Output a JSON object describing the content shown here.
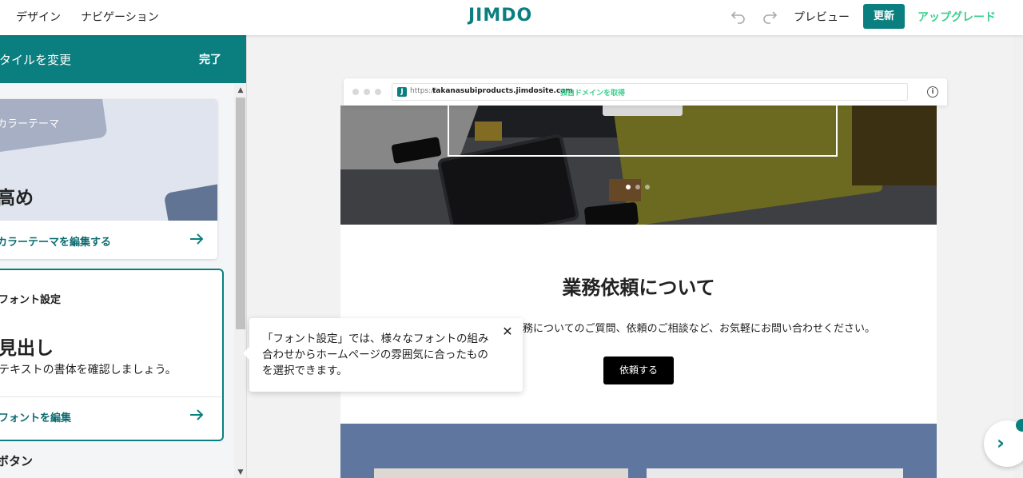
{
  "topbar": {
    "design": "デザイン",
    "navigation": "ナビゲーション",
    "logo": "JIMDO",
    "preview": "プレビュー",
    "update": "更新",
    "upgrade": "アップグレード"
  },
  "panel": {
    "title": "スタイルを変更",
    "done": "完了",
    "color_card": {
      "label": "カラーテーマ",
      "big": "高め",
      "link": "カラーテーマを編集する"
    },
    "font_card": {
      "label": "フォント設定",
      "big": "見出し",
      "desc": "テキストの書体を確認しましょう。",
      "link": "フォントを編集"
    },
    "button_section": "ボタン"
  },
  "browser": {
    "protocol": "https://",
    "host": "takanasubiproducts.jimdosite.com",
    "domain_cta": "独自ドメインを取得",
    "favicon": "J"
  },
  "site": {
    "heading": "業務依頼について",
    "text": "業務についてのご質問、依頼のご相談など、お気軽にお問い合わせください。",
    "button": "依頼する"
  },
  "tooltip": {
    "text": "「フォント設定」では、様々なフォントの組み合わせからホームページの雰囲気に合ったものを選択できます。",
    "close": "✕"
  },
  "colors": {
    "brand": "#0b7f80",
    "upgrade": "#3ccf8e",
    "band": "#5f779f"
  }
}
